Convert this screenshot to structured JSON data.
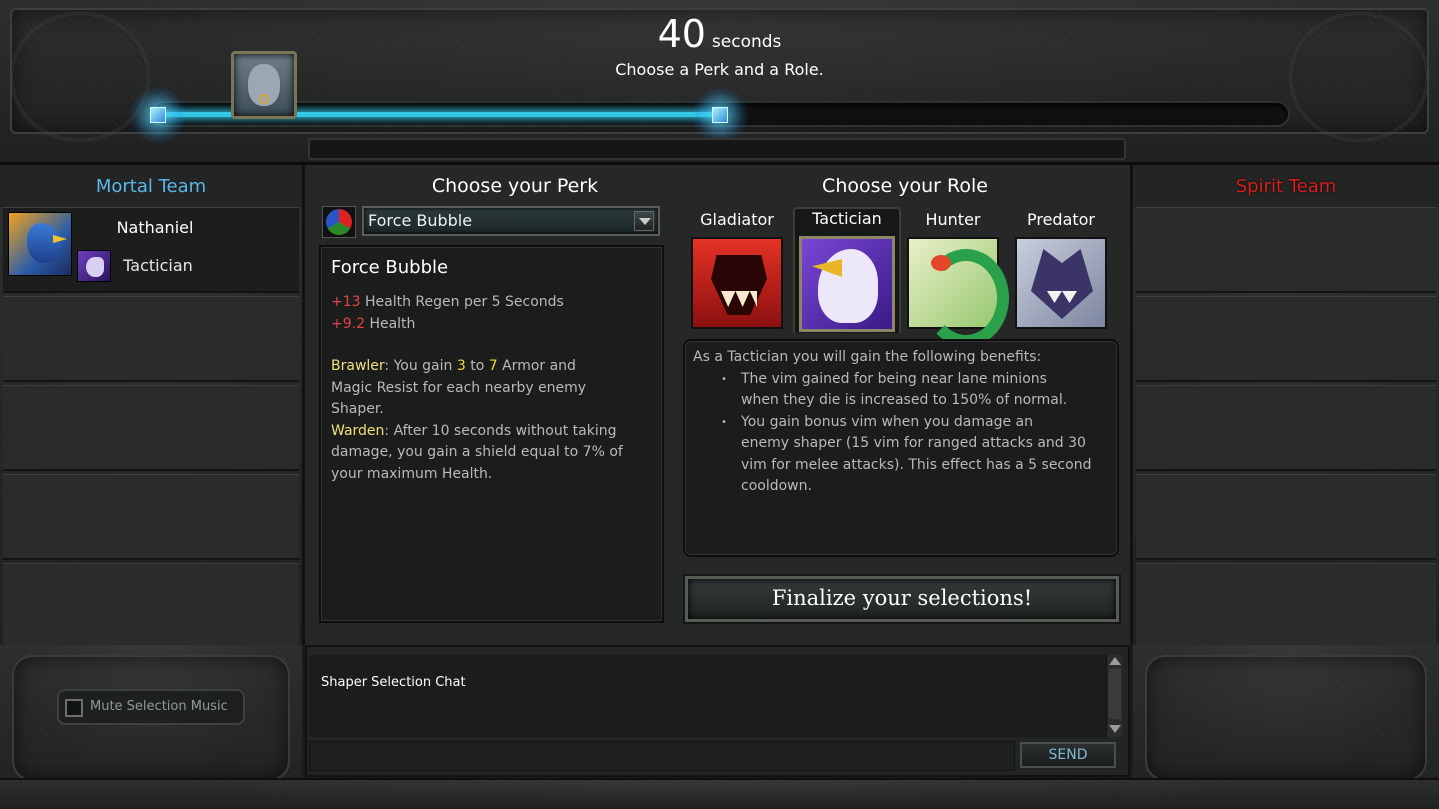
{
  "timer": {
    "value": "40",
    "unit": "seconds",
    "instruction": "Choose a Perk and a Role."
  },
  "progress": {
    "fraction": 0.4
  },
  "teams": {
    "mortal": {
      "title": "Mortal Team",
      "color": "#5ab8e8"
    },
    "spirit": {
      "title": "Spirit Team",
      "color": "#d81e1e"
    }
  },
  "player": {
    "name": "Nathaniel",
    "role": "Tactician"
  },
  "perk": {
    "section_title": "Choose your Perk",
    "selected": "Force Bubble",
    "name": "Force Bubble",
    "stats": [
      {
        "value": "+13",
        "label": " Health Regen per 5 Seconds"
      },
      {
        "value": "+9.2",
        "label": " Health"
      }
    ],
    "brawler": {
      "name": "Brawler",
      "pre": ": You gain ",
      "min": "3",
      "mid": " to ",
      "max": "7",
      "line1_end": " Armor and",
      "line2": "Magic Resist for each nearby enemy",
      "line3": "Shaper."
    },
    "warden": {
      "name": "Warden",
      "line1": ": After 10 seconds without taking",
      "line2": "damage, you gain a shield equal to 7% of",
      "line3": "your maximum Health."
    }
  },
  "roles": {
    "section_title": "Choose your Role",
    "items": [
      {
        "label": "Gladiator",
        "icon": "tiger-icon"
      },
      {
        "label": "Tactician",
        "icon": "eagle-icon",
        "selected": true
      },
      {
        "label": "Hunter",
        "icon": "serpent-icon"
      },
      {
        "label": "Predator",
        "icon": "wolf-icon"
      }
    ],
    "description": {
      "intro": "As a Tactician you will gain the following benefits:",
      "benefit_1": [
        "The vim gained for being near lane minions",
        "when they die is increased to 150% of normal."
      ],
      "benefit_2": [
        "You gain bonus vim when you damage an",
        "enemy shaper (15 vim for ranged attacks and 30",
        "vim for melee attacks). This effect has a 5 second",
        "cooldown."
      ]
    }
  },
  "finalize_label": "Finalize your selections!",
  "mute": {
    "label": "Mute Selection Music",
    "checked": false
  },
  "chat": {
    "heading": "Shaper Selection Chat",
    "send_label": "SEND"
  }
}
